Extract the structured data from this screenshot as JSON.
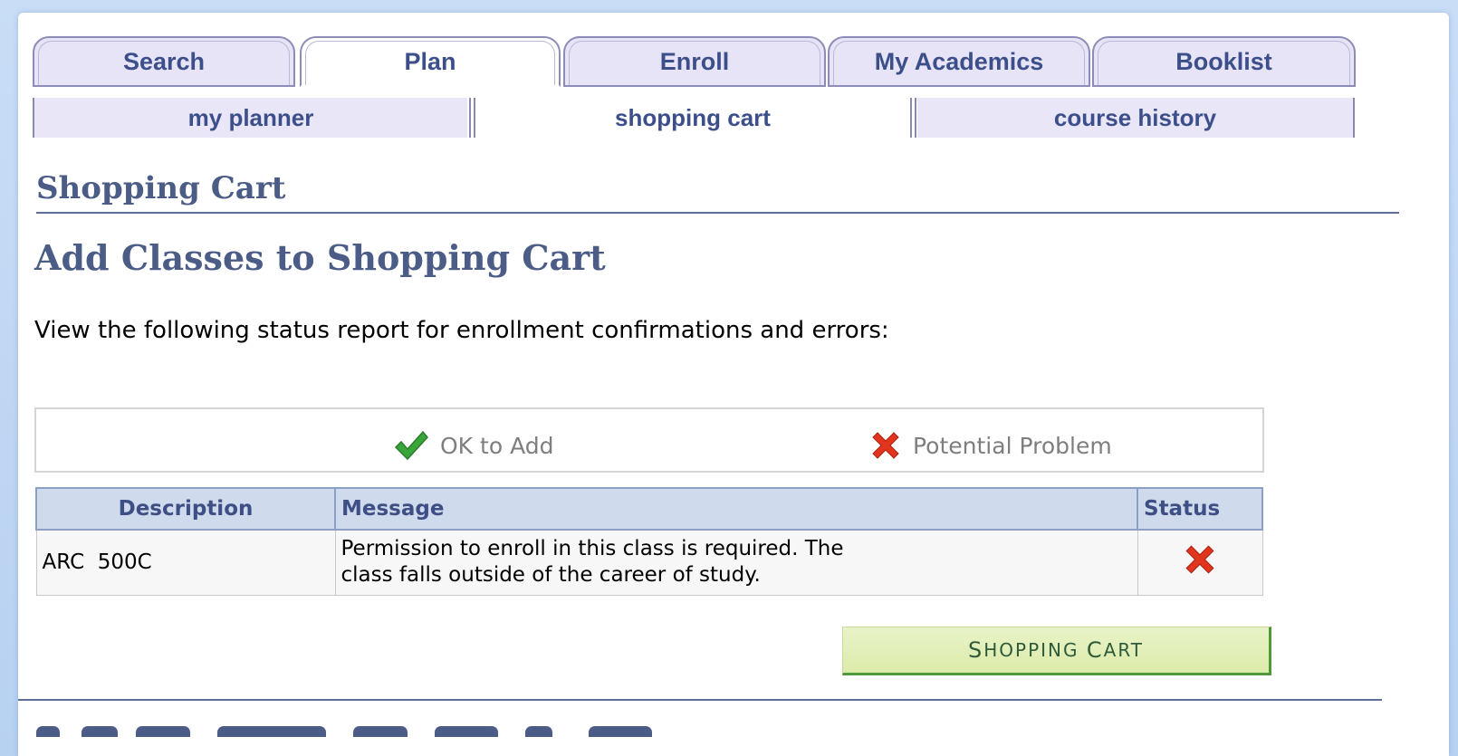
{
  "tabs": [
    {
      "label": "Search",
      "active": false
    },
    {
      "label": "Plan",
      "active": true
    },
    {
      "label": "Enroll",
      "active": false
    },
    {
      "label": "My Academics",
      "active": false
    },
    {
      "label": "Booklist",
      "active": false
    }
  ],
  "subtabs": [
    {
      "label": "my planner",
      "active": false
    },
    {
      "label": "shopping cart",
      "active": true
    },
    {
      "label": "course history",
      "active": false
    }
  ],
  "section_title": "Shopping Cart",
  "page_title": "Add Classes to Shopping Cart",
  "instructions": "View the following status report for enrollment confirmations and errors:",
  "legend": {
    "ok_label": "OK to Add",
    "problem_label": "Potential Problem"
  },
  "grid": {
    "headers": [
      "Description",
      "Message",
      "Status"
    ],
    "rows": [
      {
        "description": "ARC  500C",
        "message_line1": "Permission to enroll in this class is required. The",
        "message_line2": "class falls outside of the career of study.",
        "status_icon": "red-x-icon"
      }
    ]
  },
  "button": {
    "label_big1": "S",
    "label_small1": "HOPPING ",
    "label_big2": "C",
    "label_small2": "ART"
  },
  "colors": {
    "heading": "#4b5c86",
    "tab_text": "#3d4f8a",
    "ok_green": "#3aa53a",
    "problem_red": "#e2351f",
    "button_bg": "#dcebaa"
  }
}
